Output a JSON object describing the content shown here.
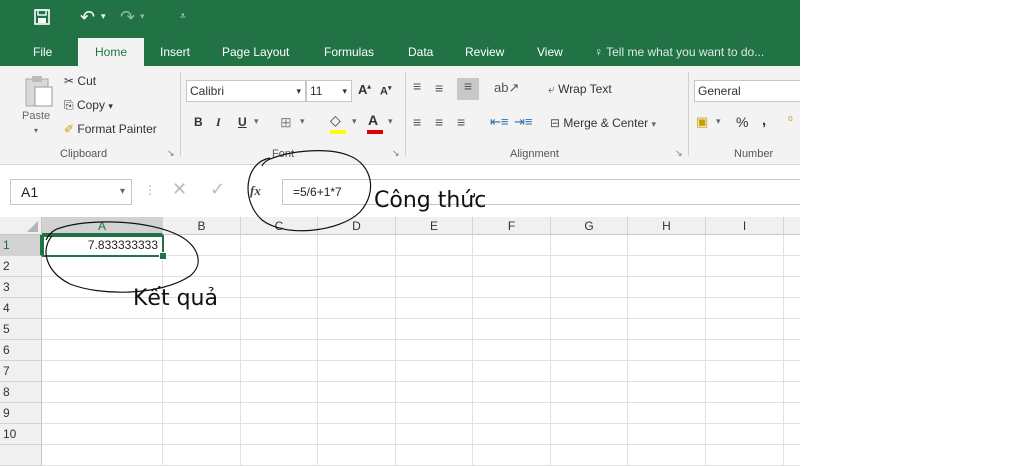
{
  "qat": {
    "save_icon": "save-icon",
    "undo_icon": "undo-icon",
    "redo_icon": "redo-icon",
    "customize_icon": "customize-qat-icon"
  },
  "tabs": [
    "File",
    "Home",
    "Insert",
    "Page Layout",
    "Formulas",
    "Data",
    "Review",
    "View"
  ],
  "tell_me": "Tell me what you want to do...",
  "ribbon": {
    "clipboard": {
      "paste": "Paste",
      "cut": "Cut",
      "copy": "Copy",
      "format_painter": "Format Painter",
      "label": "Clipboard"
    },
    "font": {
      "name": "Calibri",
      "size": "11",
      "grow": "A",
      "shrink": "A",
      "bold": "B",
      "italic": "I",
      "underline": "U",
      "font_color_letter": "A",
      "label": "Font"
    },
    "alignment": {
      "wrap_text": "Wrap Text",
      "merge_center": "Merge & Center",
      "label": "Alignment"
    },
    "number": {
      "format": "General",
      "percent": "%",
      "comma": ",",
      "label": "Number"
    }
  },
  "formula_bar": {
    "name_box": "A1",
    "fx": "fx",
    "formula": "=5/6+1*7"
  },
  "sheet": {
    "columns": [
      "A",
      "B",
      "C",
      "D",
      "E",
      "F",
      "G",
      "H",
      "I"
    ],
    "rows": [
      "1",
      "2",
      "3",
      "4",
      "5",
      "6",
      "7",
      "8",
      "9",
      "10"
    ],
    "a1_value": "7.833333333"
  },
  "annotations": {
    "formula_note": "Công thức",
    "result_note": "Kết quả"
  },
  "colors": {
    "excel_green": "#217346",
    "ribbon_bg": "#f3f3f3",
    "grid_line": "#e1e1e1"
  }
}
